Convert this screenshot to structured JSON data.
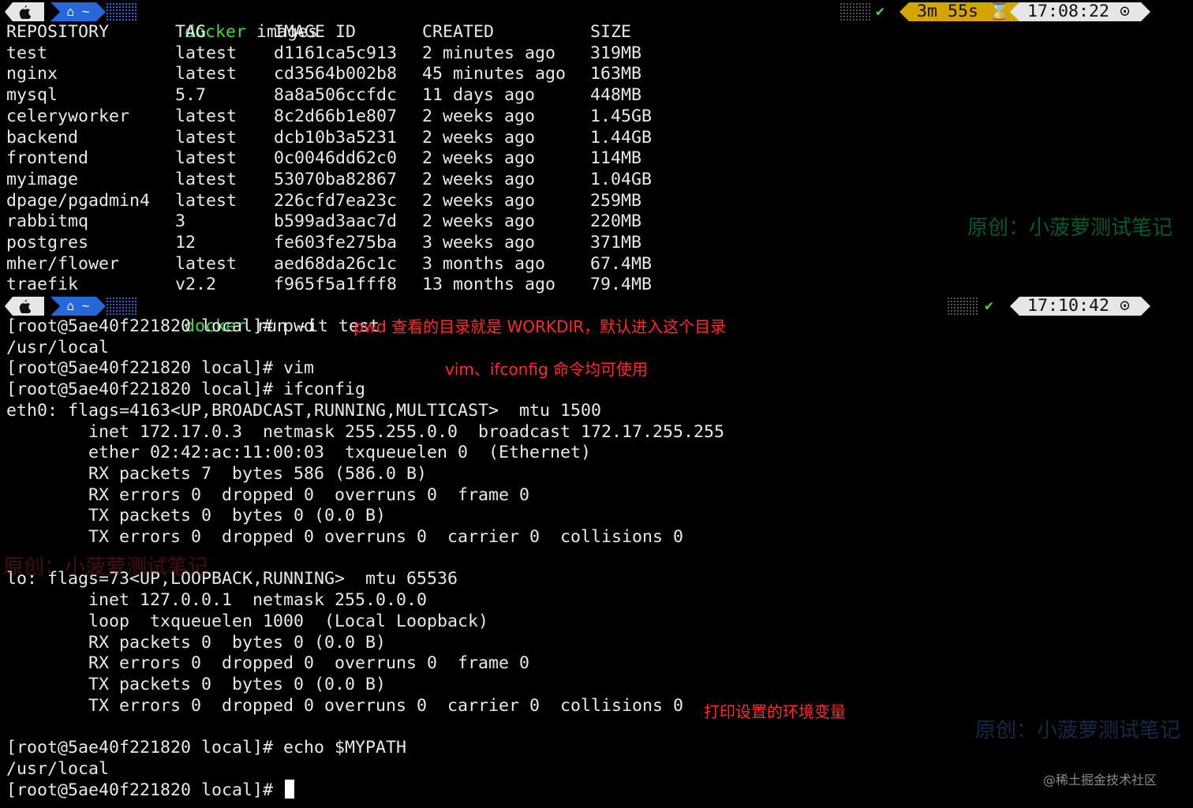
{
  "prompt1": {
    "apple_icon": "apple-icon",
    "home_icon": "home-icon",
    "path": "~",
    "cmd_keyword": "docker",
    "cmd_rest": " images",
    "status_check": "✔",
    "duration": "3m 55s ⌛",
    "clock": "17:08:22 ⊙"
  },
  "images_table": {
    "headers": [
      "REPOSITORY",
      "TAG",
      "IMAGE ID",
      "CREATED",
      "SIZE"
    ],
    "rows": [
      [
        "test",
        "latest",
        "d1161ca5c913",
        "2 minutes ago",
        "319MB"
      ],
      [
        "nginx",
        "latest",
        "cd3564b002b8",
        "45 minutes ago",
        "163MB"
      ],
      [
        "mysql",
        "5.7",
        "8a8a506ccfdc",
        "11 days ago",
        "448MB"
      ],
      [
        "celeryworker",
        "latest",
        "8c2d66b1e807",
        "2 weeks ago",
        "1.45GB"
      ],
      [
        "backend",
        "latest",
        "dcb10b3a5231",
        "2 weeks ago",
        "1.44GB"
      ],
      [
        "frontend",
        "latest",
        "0c0046dd62c0",
        "2 weeks ago",
        "114MB"
      ],
      [
        "myimage",
        "latest",
        "53070ba82867",
        "2 weeks ago",
        "1.04GB"
      ],
      [
        "dpage/pgadmin4",
        "latest",
        "226cfd7ea23c",
        "2 weeks ago",
        "259MB"
      ],
      [
        "rabbitmq",
        "3",
        "b599ad3aac7d",
        "2 weeks ago",
        "220MB"
      ],
      [
        "postgres",
        "12",
        "fe603fe275ba",
        "3 weeks ago",
        "371MB"
      ],
      [
        "mher/flower",
        "latest",
        "aed68da26c1c",
        "3 months ago",
        "67.4MB"
      ],
      [
        "traefik",
        "v2.2",
        "f965f5a1fff8",
        "13 months ago",
        "79.4MB"
      ]
    ]
  },
  "prompt2": {
    "path": "~",
    "cmd_keyword": "docker",
    "cmd_rest": " run -it test",
    "status_check": "✔",
    "clock": "17:10:42 ⊙"
  },
  "shell_lines": [
    "[root@5ae40f221820 local]# pwd",
    "/usr/local",
    "[root@5ae40f221820 local]# vim",
    "[root@5ae40f221820 local]# ifconfig",
    "eth0: flags=4163<UP,BROADCAST,RUNNING,MULTICAST>  mtu 1500",
    "        inet 172.17.0.3  netmask 255.255.0.0  broadcast 172.17.255.255",
    "        ether 02:42:ac:11:00:03  txqueuelen 0  (Ethernet)",
    "        RX packets 7  bytes 586 (586.0 B)",
    "        RX errors 0  dropped 0  overruns 0  frame 0",
    "        TX packets 0  bytes 0 (0.0 B)",
    "        TX errors 0  dropped 0 overruns 0  carrier 0  collisions 0",
    "",
    "lo: flags=73<UP,LOOPBACK,RUNNING>  mtu 65536",
    "        inet 127.0.0.1  netmask 255.0.0.0",
    "        loop  txqueuelen 1000  (Local Loopback)",
    "        RX packets 0  bytes 0 (0.0 B)",
    "        RX errors 0  dropped 0  overruns 0  frame 0",
    "        TX packets 0  bytes 0 (0.0 B)",
    "        TX errors 0  dropped 0 overruns 0  carrier 0  collisions 0",
    "",
    "[root@5ae40f221820 local]# echo $MYPATH",
    "/usr/local",
    "[root@5ae40f221820 local]# "
  ],
  "annotations": {
    "pwd_note": "pwd 查看的目录就是 WORKDIR，默认进入这个目录",
    "vim_note": "vim、ifconfig 命令均可使用",
    "env_note": "打印设置的环境变量"
  },
  "watermarks": {
    "wm1": "原创：小菠萝测试笔记",
    "wm2": "原创：小菠萝测试笔记",
    "wm3": "原创：小菠萝测试笔记",
    "juejin": "@稀土掘金技术社区"
  },
  "colors": {
    "background": "#000000",
    "text": "#e8e8e8",
    "prompt_keyword": "#4dd14d",
    "home_segment": "#2767d8",
    "duration_segment": "#d6a400",
    "annotation": "#ff2a2a"
  }
}
